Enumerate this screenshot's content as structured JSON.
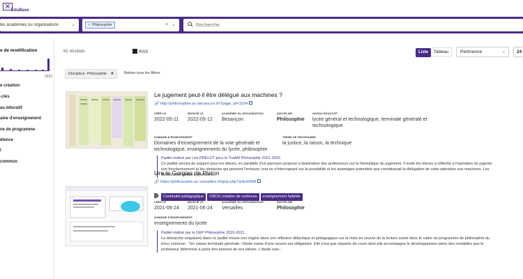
{
  "header": {
    "logo_text": "EduBase"
  },
  "filters": {
    "academy_select": "les académies ou organisations",
    "discipline_tag": "Philosophie",
    "search_placeholder": "Recherche"
  },
  "sidebar": {
    "title": "e de modification",
    "year": "2022",
    "items": [
      "e création",
      "-clés",
      "au éducatif",
      "aine d'enseignement",
      "ne de programme",
      "étence",
      "l",
      "commun"
    ],
    "histogram": [
      0.25,
      0.15,
      0.12,
      0.1,
      0.1,
      0.1,
      1.0
    ]
  },
  "toolbar": {
    "results_count": "62 résultats",
    "rss_label": "RSS",
    "view_list": "Liste",
    "view_table": "Tableau",
    "sort_value": "Pertinence",
    "per_page": "24"
  },
  "active_filters": {
    "chip_label": "Discipline: Philosophie",
    "chip_close": "X",
    "clear_all": "Retirer tous les filtres"
  },
  "labels": {
    "created": "CRÉÉ LE",
    "modified": "MODIFIÉ LE",
    "academy": "ACADÉMIE OU ORGANISATION",
    "discipline": "DISCIPLINE",
    "level": "NIVEAU ÉDUCATIF",
    "domain": "DOMAINE D'ENSEIGNEMENT",
    "theme": "THÈME DE PROGRAMME"
  },
  "results": [
    {
      "title": "Le jugement peut-il être délégué aux machines ?",
      "url": "http://philosophie.ac-besancon.fr/?page_id=1634",
      "created": "2022-05-11",
      "modified": "2022-05-12",
      "academy": "Besançon",
      "discipline": "Philosophie",
      "level": "lycée général et technologique, terminale générale et technologique",
      "domain": "Domaines d'enseignement de la voie générale et technologique, enseignements du lycée, philosophie",
      "theme": "la justice, la raison, la technique",
      "desc": [
        "Padlet réalisé par Léa PRELOT pour le TraAM Philosophie 2021-2022.",
        "Ce padlet servira de support pour les élèves, en parallèle d'un parcours proposé à destination des professeurs sur la thématique du jugement. Il invite les élèves à réfléchir à l'opération du jugeme",
        "son fonctionnement et les obstacles qui peuvent l'entraver, tout en s'interrogeant sur la possibilité et les avantages potentiels que constituerait la délégation de cette opération aux machines. Les",
        "élèves sont invités à prendre c..."
      ]
    },
    {
      "title": "Lire le Gorgias de Platon",
      "url": "https://philosophie.ac-versailles.fr/spip.php?article898",
      "tags": [
        "Continuité pédagogique",
        "CRCN création de contenus",
        "enseignement hybride"
      ],
      "created": "2021-06-24",
      "modified": "2021-06-24",
      "academy": "Versailles",
      "discipline": "Philosophie",
      "domain": "enseignements du lycée",
      "desc": [
        "Padlet réalisé par le GEP Philosophie 2020-2021.",
        "La démarche esquissée dans ce padlet trouve son origine dans une réflexion didactique et pédagogique sur la mise en oeuvre de la lecture suivie dans le cadre du programme de philosophie du",
        "tronc commun : \"En classe terminale générale, l'étude suivie d'une oeuvre est obligatoire. Elle n'est pas séparée du cours dont elle accompagne le développement selon des modalités que le",
        "professeur détermine à partir des besoins de ses élèves. L'étude suiv..."
      ]
    }
  ],
  "colors": {
    "brand": "#4a2c87",
    "link": "#2d5fb0"
  }
}
